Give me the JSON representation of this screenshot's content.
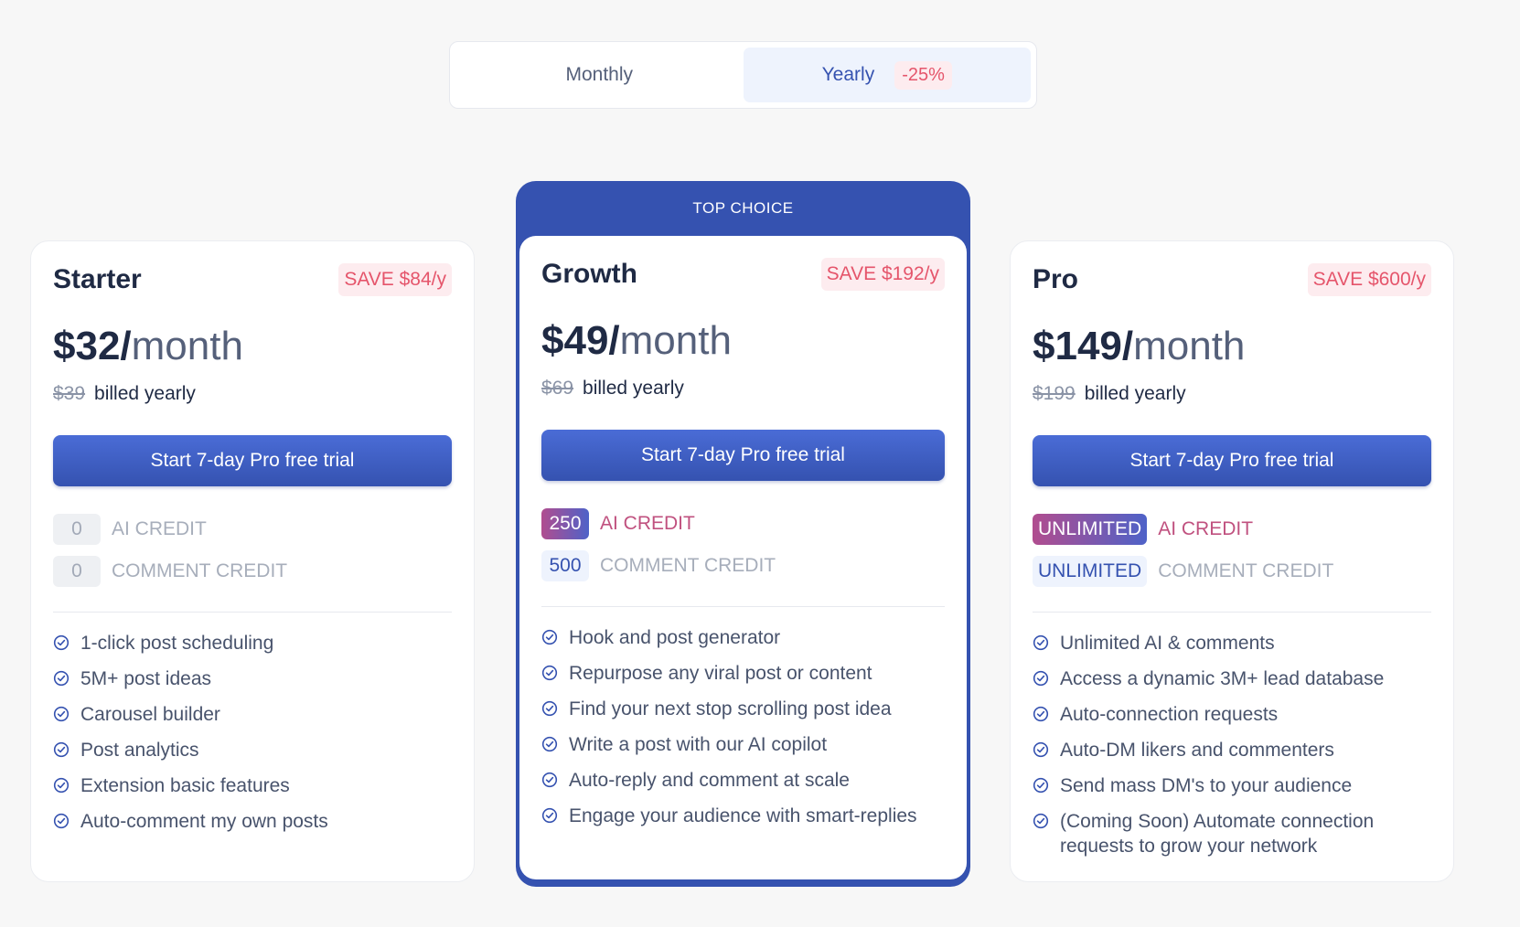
{
  "billing_toggle": {
    "monthly_label": "Monthly",
    "yearly_label": "Yearly",
    "yearly_discount": "-25%",
    "selected": "Yearly"
  },
  "plans": [
    {
      "name": "Starter",
      "save_badge": "SAVE $84/y",
      "price": "$32/",
      "price_unit": "month",
      "old_price": "$39",
      "billing_note": "billed yearly",
      "cta_label": "Start 7-day Pro free trial",
      "credits": [
        {
          "value": "0",
          "label": "AI CREDIT"
        },
        {
          "value": "0",
          "label": "COMMENT CREDIT"
        }
      ],
      "features": [
        "1-click post scheduling",
        "5M+ post ideas",
        "Carousel builder",
        "Post analytics",
        "Extension basic features",
        "Auto-comment my own posts"
      ]
    },
    {
      "featured_label": "TOP CHOICE",
      "name": "Growth",
      "save_badge": "SAVE $192/y",
      "price": "$49/",
      "price_unit": "month",
      "old_price": "$69",
      "billing_note": "billed yearly",
      "cta_label": "Start 7-day Pro free trial",
      "credits": [
        {
          "value": "250",
          "label": "AI CREDIT"
        },
        {
          "value": "500",
          "label": "COMMENT CREDIT"
        }
      ],
      "features": [
        "Hook and post generator",
        "Repurpose any viral post or content",
        "Find your next stop scrolling post idea",
        "Write a post with our AI copilot",
        "Auto-reply and comment at scale",
        "Engage your audience with smart-replies"
      ]
    },
    {
      "name": "Pro",
      "save_badge": "SAVE $600/y",
      "price": "$149/",
      "price_unit": "month",
      "old_price": "$199",
      "billing_note": "billed yearly",
      "cta_label": "Start 7-day Pro free trial",
      "credits": [
        {
          "value": "UNLIMITED",
          "label": "AI CREDIT"
        },
        {
          "value": "UNLIMITED",
          "label": "COMMENT CREDIT"
        }
      ],
      "features": [
        "Unlimited AI & comments",
        "Access a dynamic 3M+ lead database",
        "Auto-connection requests",
        "Auto-DM likers and commenters",
        "Send mass DM's to your audience",
        "(Coming Soon) Automate connection requests to grow your network"
      ]
    }
  ],
  "colors": {
    "accent": "#3552b0",
    "save_badge_text": "#e5556b",
    "background": "#f7f7f7"
  },
  "icons": {
    "feature_check": "check-circle-icon"
  }
}
